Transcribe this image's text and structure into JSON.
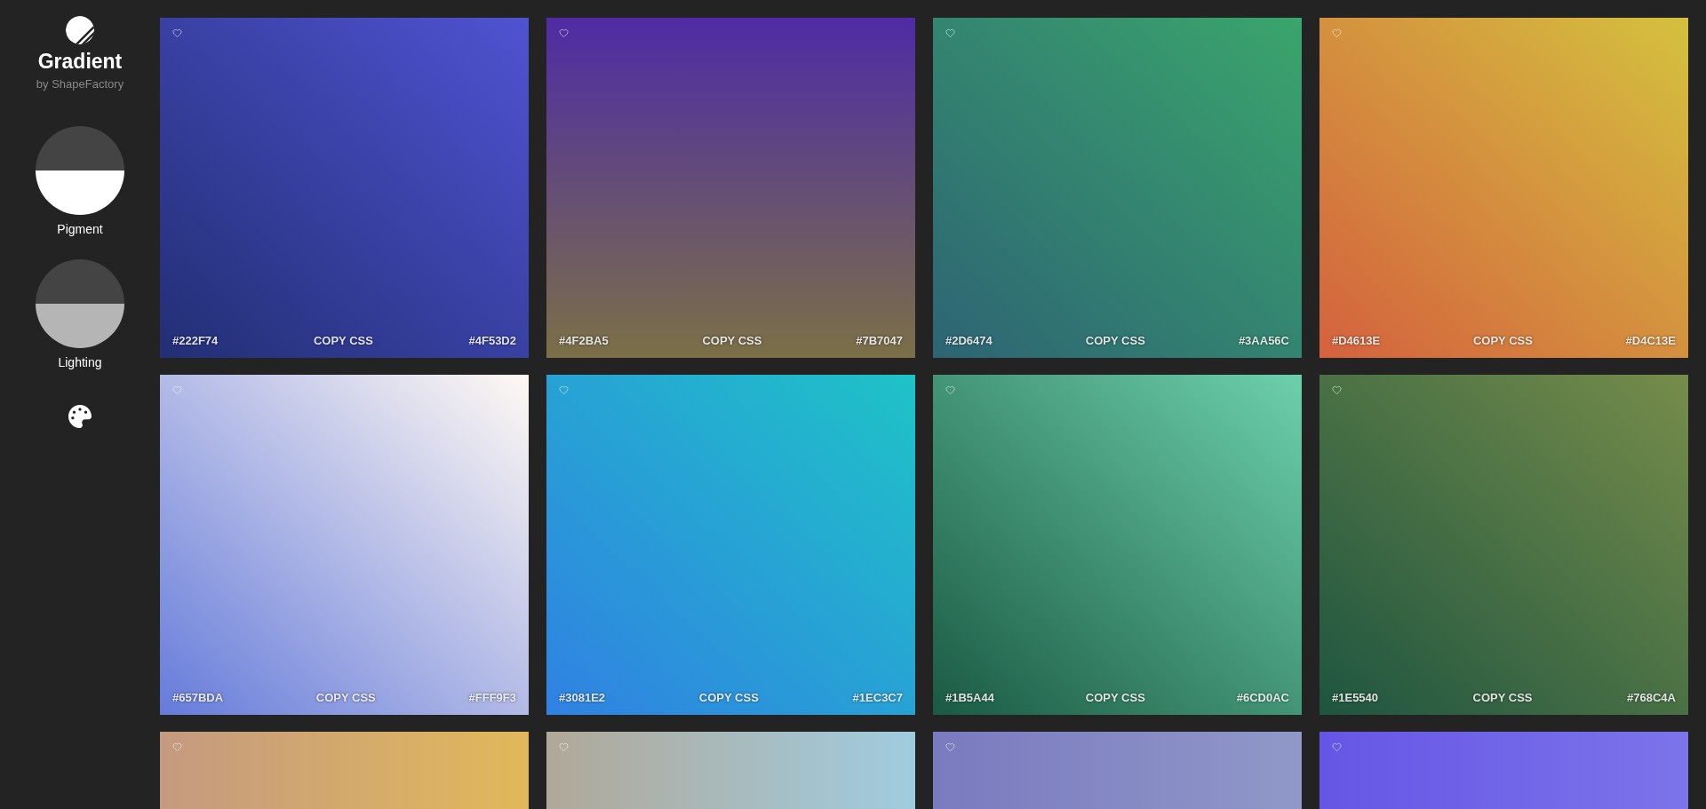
{
  "brand": {
    "title": "Gradient",
    "subtitle": "by ShapeFactory"
  },
  "controls": [
    {
      "label": "Pigment",
      "color": "#ffffff"
    },
    {
      "label": "Lighting",
      "color": "#b5b5b5"
    }
  ],
  "cards": [
    {
      "colors": [
        "#222F74",
        "#4F53D2"
      ],
      "reverse": false,
      "copy_label": "COPY CSS"
    },
    {
      "colors": [
        "#4F2BA5",
        "#7B7047"
      ],
      "reverse": true,
      "copy_label": "COPY CSS"
    },
    {
      "colors": [
        "#2D6474",
        "#3AA56C"
      ],
      "reverse": false,
      "copy_label": "COPY CSS"
    },
    {
      "colors": [
        "#D4613E",
        "#D4C13E"
      ],
      "reverse": false,
      "copy_label": "COPY CSS"
    },
    {
      "colors": [
        "#657BDA",
        "#FFF9F3"
      ],
      "reverse": false,
      "copy_label": "COPY CSS"
    },
    {
      "colors": [
        "#3081E2",
        "#1EC3C7"
      ],
      "reverse": false,
      "copy_label": "COPY CSS"
    },
    {
      "colors": [
        "#1B5A44",
        "#6CD0AC"
      ],
      "reverse": false,
      "copy_label": "COPY CSS"
    },
    {
      "colors": [
        "#1E5540",
        "#768C4A"
      ],
      "reverse": false,
      "copy_label": "COPY CSS"
    },
    {
      "stops": [
        {
          "color": "#c49a80"
        },
        {
          "color": "#e2b85a"
        }
      ],
      "reverse": false
    },
    {
      "stops": [
        {
          "color": "#b0a898"
        },
        {
          "color": "#a0cce0"
        }
      ],
      "reverse": false
    },
    {
      "stops": [
        {
          "color": "#7a7ac0"
        },
        {
          "color": "#9098c8"
        }
      ],
      "reverse": false
    },
    {
      "stops": [
        {
          "color": "#6656e6"
        },
        {
          "color": "#7c74ea"
        }
      ],
      "reverse": false
    }
  ]
}
